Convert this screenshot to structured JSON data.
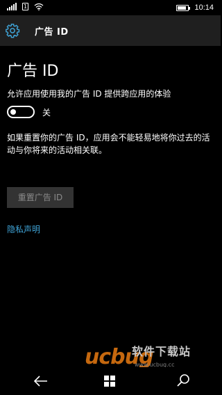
{
  "status_bar": {
    "time": "10:14",
    "sim_label": "1",
    "icons": [
      "signal-icon",
      "sim-icon",
      "wifi-icon",
      "battery-icon"
    ],
    "battery_level": 0.8
  },
  "header": {
    "title": "广告 ID",
    "icon": "gear-icon"
  },
  "main": {
    "page_title": "广告 ID",
    "toggle_label": "允许应用使用我的广告 ID 提供跨应用的体验",
    "toggle_state": "关",
    "toggle_on": false,
    "description": "如果重置你的广告 ID，应用会不能轻易地将你过去的活动与你将来的活动相关联。",
    "reset_button": "重置广告 ID",
    "privacy_link": "隐私声明"
  },
  "nav": {
    "back_icon": "back-arrow-icon",
    "home_icon": "windows-logo-icon",
    "search_icon": "search-icon"
  },
  "watermark": {
    "logo_text": "ucbug",
    "cn_text": "软件下载站",
    "domain": "www.ucbug.cc"
  },
  "colors": {
    "accent": "#3fa3d6",
    "header_bg": "#1f1f1f",
    "button_bg": "#333333",
    "watermark": "#e87b12"
  }
}
